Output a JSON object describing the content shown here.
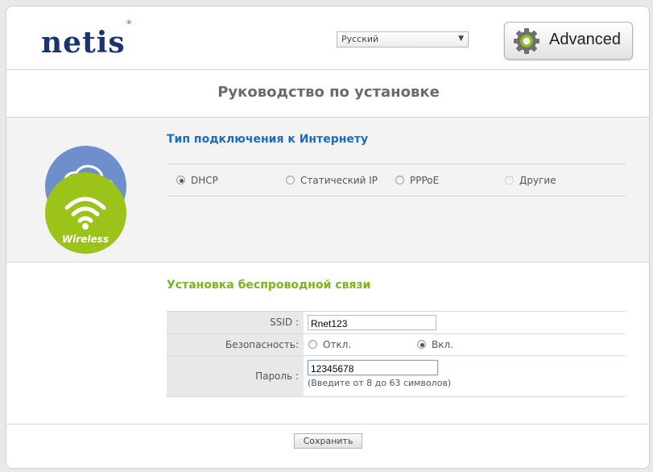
{
  "header": {
    "logo_text": "netis",
    "logo_mark": "®",
    "language_selected": "Русский",
    "advanced_label": "Advanced"
  },
  "page_title": "Руководство по установке",
  "internet": {
    "title": "Тип подключения к Интернету",
    "icon_label": "internet",
    "options": [
      {
        "label": "DHCP",
        "checked": true,
        "disabled": false
      },
      {
        "label": "Статический IP",
        "checked": false,
        "disabled": false
      },
      {
        "label": "PPPoE",
        "checked": false,
        "disabled": false
      },
      {
        "label": "Другие",
        "checked": false,
        "disabled": true
      }
    ]
  },
  "wireless": {
    "title": "Установка беспроводной связи",
    "icon_label": "Wireless",
    "ssid_label": "SSID :",
    "ssid_value": "Rnet123",
    "security_label": "Безопасность:",
    "security_off": "Откл.",
    "security_on": "Вкл.",
    "password_label": "Пароль :",
    "password_value": "12345678",
    "password_hint": "(Введите от 8 до 63 символов)"
  },
  "save_label": "Сохранить",
  "colors": {
    "internet_circle": "#6f8ecc",
    "wireless_circle": "#9cc31a",
    "internet_title": "#1b6bc0",
    "wireless_title": "#7ab51d"
  }
}
